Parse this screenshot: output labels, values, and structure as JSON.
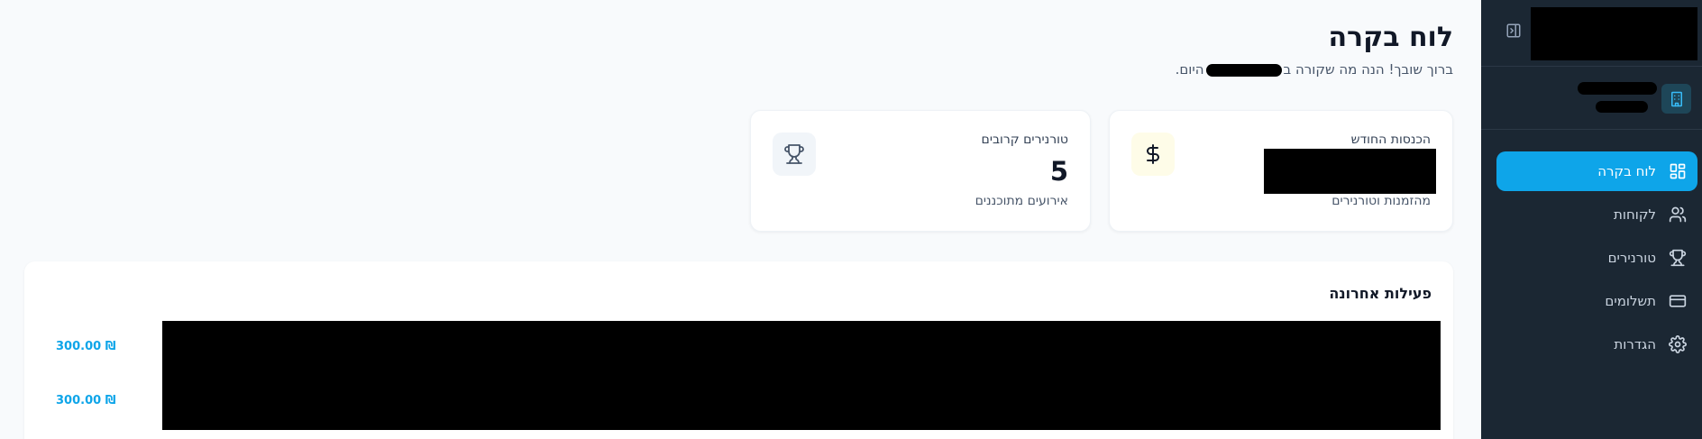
{
  "page": {
    "title": "לוח בקרה",
    "subtitle_before": "ברוך שובך! הנה מה שקורה ב",
    "subtitle_after": "היום."
  },
  "sidebar": {
    "items": [
      {
        "label": "לוח בקרה",
        "icon": "dashboard-icon",
        "active": true
      },
      {
        "label": "לקוחות",
        "icon": "users-icon",
        "active": false
      },
      {
        "label": "טורנירים",
        "icon": "trophy-icon",
        "active": false
      },
      {
        "label": "תשלומים",
        "icon": "credit-card-icon",
        "active": false
      },
      {
        "label": "הגדרות",
        "icon": "settings-icon",
        "active": false
      }
    ]
  },
  "stats": {
    "revenue": {
      "label": "הכנסות החודש",
      "description": "מהזמנות וטורנירים",
      "icon": "dollar-icon"
    },
    "tournaments": {
      "label": "טורנירים קרובים",
      "value": "5",
      "description": "אירועים מתוכננים",
      "icon": "trophy-icon"
    }
  },
  "activity": {
    "title": "פעילות אחרונה",
    "amounts": [
      "300.00 ₪",
      "300.00 ₪"
    ]
  },
  "colors": {
    "sidebar_bg": "#1b2733",
    "accent": "#0ea5e9",
    "page_bg": "#f8fafc"
  }
}
